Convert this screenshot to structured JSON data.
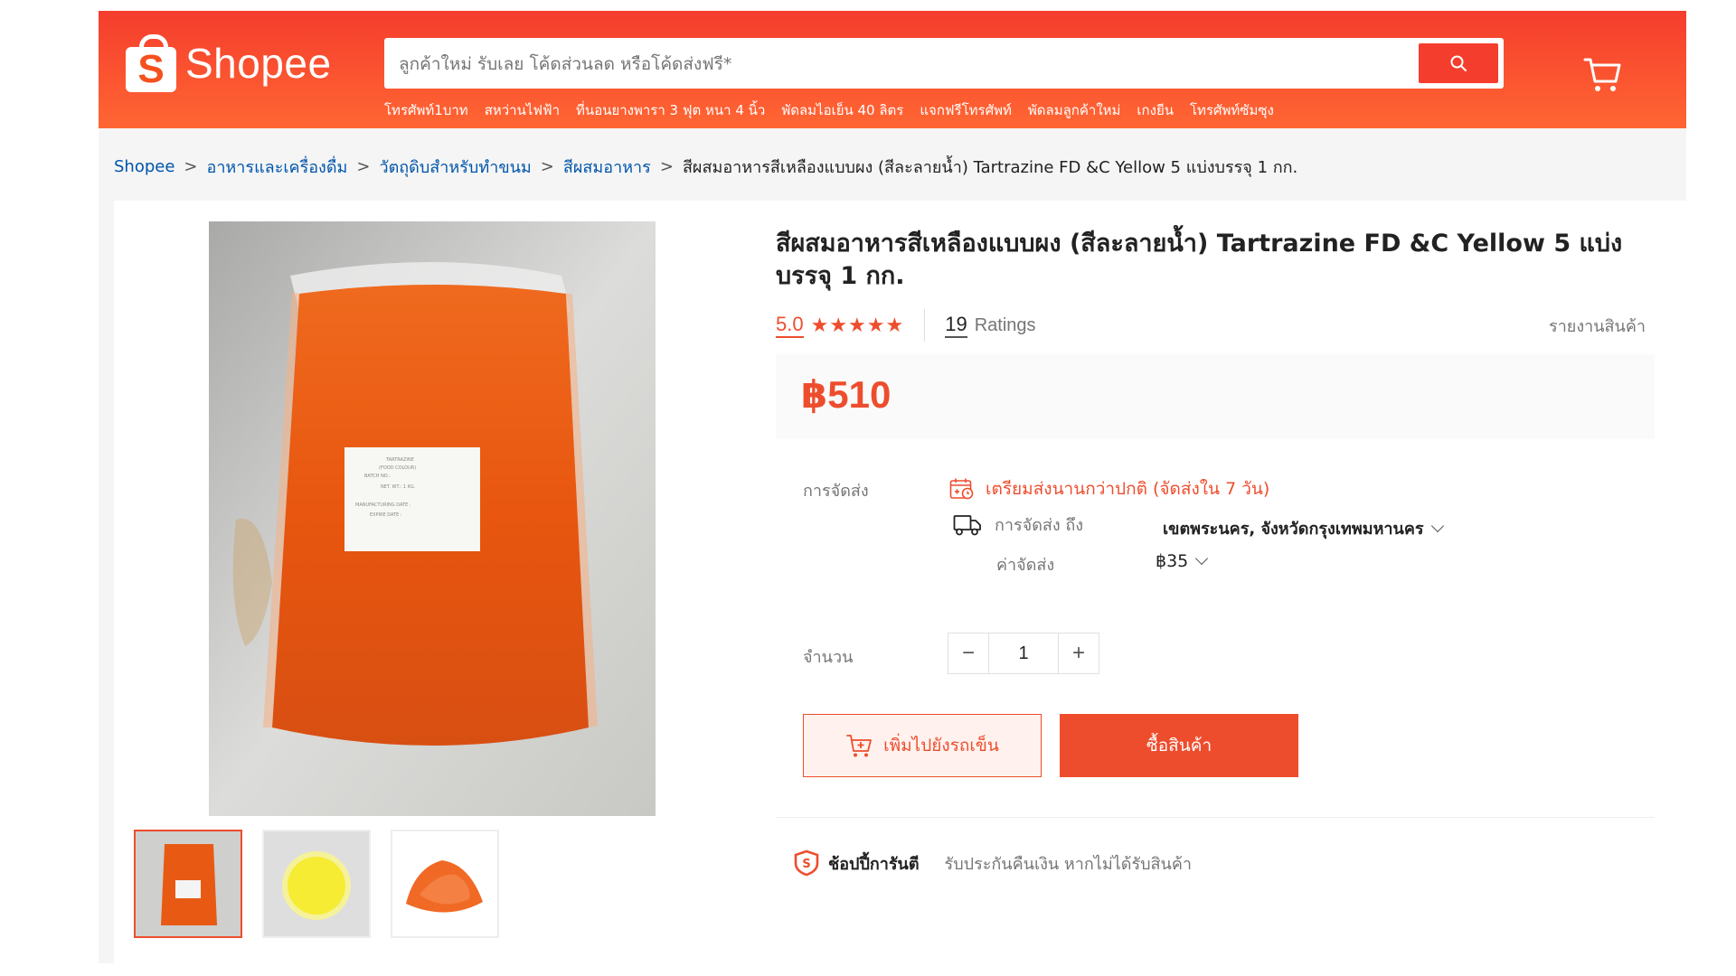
{
  "header": {
    "logo_text": "Shopee",
    "logo_letter": "S",
    "search_placeholder": "ลูกค้าใหม่ รับเลย โค้ดส่วนลด หรือโค้ดส่งฟรี*",
    "quick_links": [
      "โทรศัพท์1บาท",
      "สหว่านไฟฟ้า",
      "ที่นอนยางพารา 3 ฟุต หนา 4 นิ้ว",
      "พัดลมไอเย็น 40 ลิตร",
      "แจกฟรีโทรศัพท์",
      "พัดลมลูกค้าใหม่",
      "เกงยีน",
      "โทรศัพท์ซัมซุง"
    ],
    "brand_color": "#ee4d2d"
  },
  "breadcrumb": {
    "items": [
      "Shopee",
      "อาหารและเครื่องดื่ม",
      "วัตถุดิบสำหรับทำขนม",
      "สีผสมอาหาร"
    ],
    "current": "สีผสมอาหารสีเหลืองแบบผง (สีละลายน้ำ) Tartrazine FD &C Yellow 5 แบ่งบรรจุ 1 กก."
  },
  "product": {
    "title": "สีผสมอาหารสีเหลืองแบบผง (สีละลายน้ำ) Tartrazine FD &C Yellow 5 แบ่งบรรจุ 1 กก.",
    "rating_score": "5.0",
    "stars": "★★★★★",
    "ratings_count": "19",
    "ratings_label": "Ratings",
    "report_label": "รายงานสินค้า",
    "price": "฿510",
    "label_card": {
      "l1": "TARTRAZINE",
      "l2": "(FOOD COLOUR)",
      "l3": "BATCH NO.:",
      "l4": "NET. WT.: 1 KG.",
      "l5": "MANUFACTURING DATE :",
      "l6": "EXPIRE DATE :"
    }
  },
  "shipping": {
    "label": "การจัดส่ง",
    "warning": "เตรียมส่งนานกว่าปกติ (จัดส่งใน 7 วัน)",
    "to_label": "การจัดส่ง ถึง",
    "destination": "เขตพระนคร, จังหวัดกรุงเทพมหานคร",
    "fee_label": "ค่าจัดส่ง",
    "fee": "฿35"
  },
  "quantity": {
    "label": "จำนวน",
    "value": "1",
    "minus": "−",
    "plus": "+"
  },
  "actions": {
    "add_to_cart": "เพิ่มไปยังรถเข็น",
    "buy_now": "ซื้อสินค้า"
  },
  "guarantee": {
    "title": "ช้อปปี้การันตี",
    "text": "รับประกันคืนเงิน หากไม่ได้รับสินค้า"
  }
}
